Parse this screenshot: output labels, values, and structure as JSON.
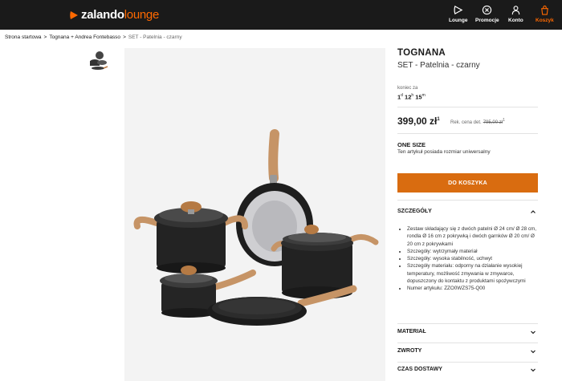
{
  "header": {
    "logo_part1": "zalando",
    "logo_part2": "lounge",
    "nav": [
      {
        "label": "Lounge",
        "icon": "lounge-icon"
      },
      {
        "label": "Promocje",
        "icon": "promo-icon"
      },
      {
        "label": "Konto",
        "icon": "account-icon"
      },
      {
        "label": "Koszyk",
        "icon": "cart-icon"
      }
    ],
    "colors": {
      "background": "#1a1a1a",
      "accent": "#ff6900"
    }
  },
  "breadcrumb": {
    "items": [
      "Strona startowa",
      "Tognana + Andrea Fontebasso",
      "SET - Patelnia - czarny"
    ],
    "separator": ">"
  },
  "product": {
    "brand": "TOGNANA",
    "name": "SET - Patelnia - czarny",
    "ends_label": "koniec za",
    "timer": {
      "d": "1",
      "h": "12",
      "m": "15",
      "d_unit": "d",
      "h_unit": "h",
      "m_unit": "m"
    },
    "price": "399,00 zł",
    "price_note": "1",
    "rrp_label": "Rek. cena det.",
    "rrp_value": "795,00 zł",
    "rrp_note": "1",
    "size_title": "ONE SIZE",
    "size_desc": "Ten artykuł posiada rozmiar uniwersalny",
    "add_to_cart": "DO KOSZYKA",
    "accent_color": "#d96c10"
  },
  "sections": {
    "details_title": "SZCZEGÓŁY",
    "details": [
      "Zestaw składający się z dwóch patelni Ø 24 cm/ Ø 28 cm, rondla Ø 16 cm z pokrywką i dwóch garnków Ø 20 cm/ Ø 20 cm z pokrywkami",
      "Szczegóły: wytrzymały materiał",
      "Szczegóły: wysoka stabilność, uchwyt",
      "Szczegóły materiału: odporny na działanie wysokiej temperatury, możliwość zmywania w zmywarce, dopuszczony do kontaktu z produktami spożywczymi",
      "Numer artykułu: ZZO0WZS75-Q00"
    ],
    "material_title": "MATERIAŁ",
    "returns_title": "ZWROTY",
    "delivery_title": "CZAS DOSTAWY"
  }
}
